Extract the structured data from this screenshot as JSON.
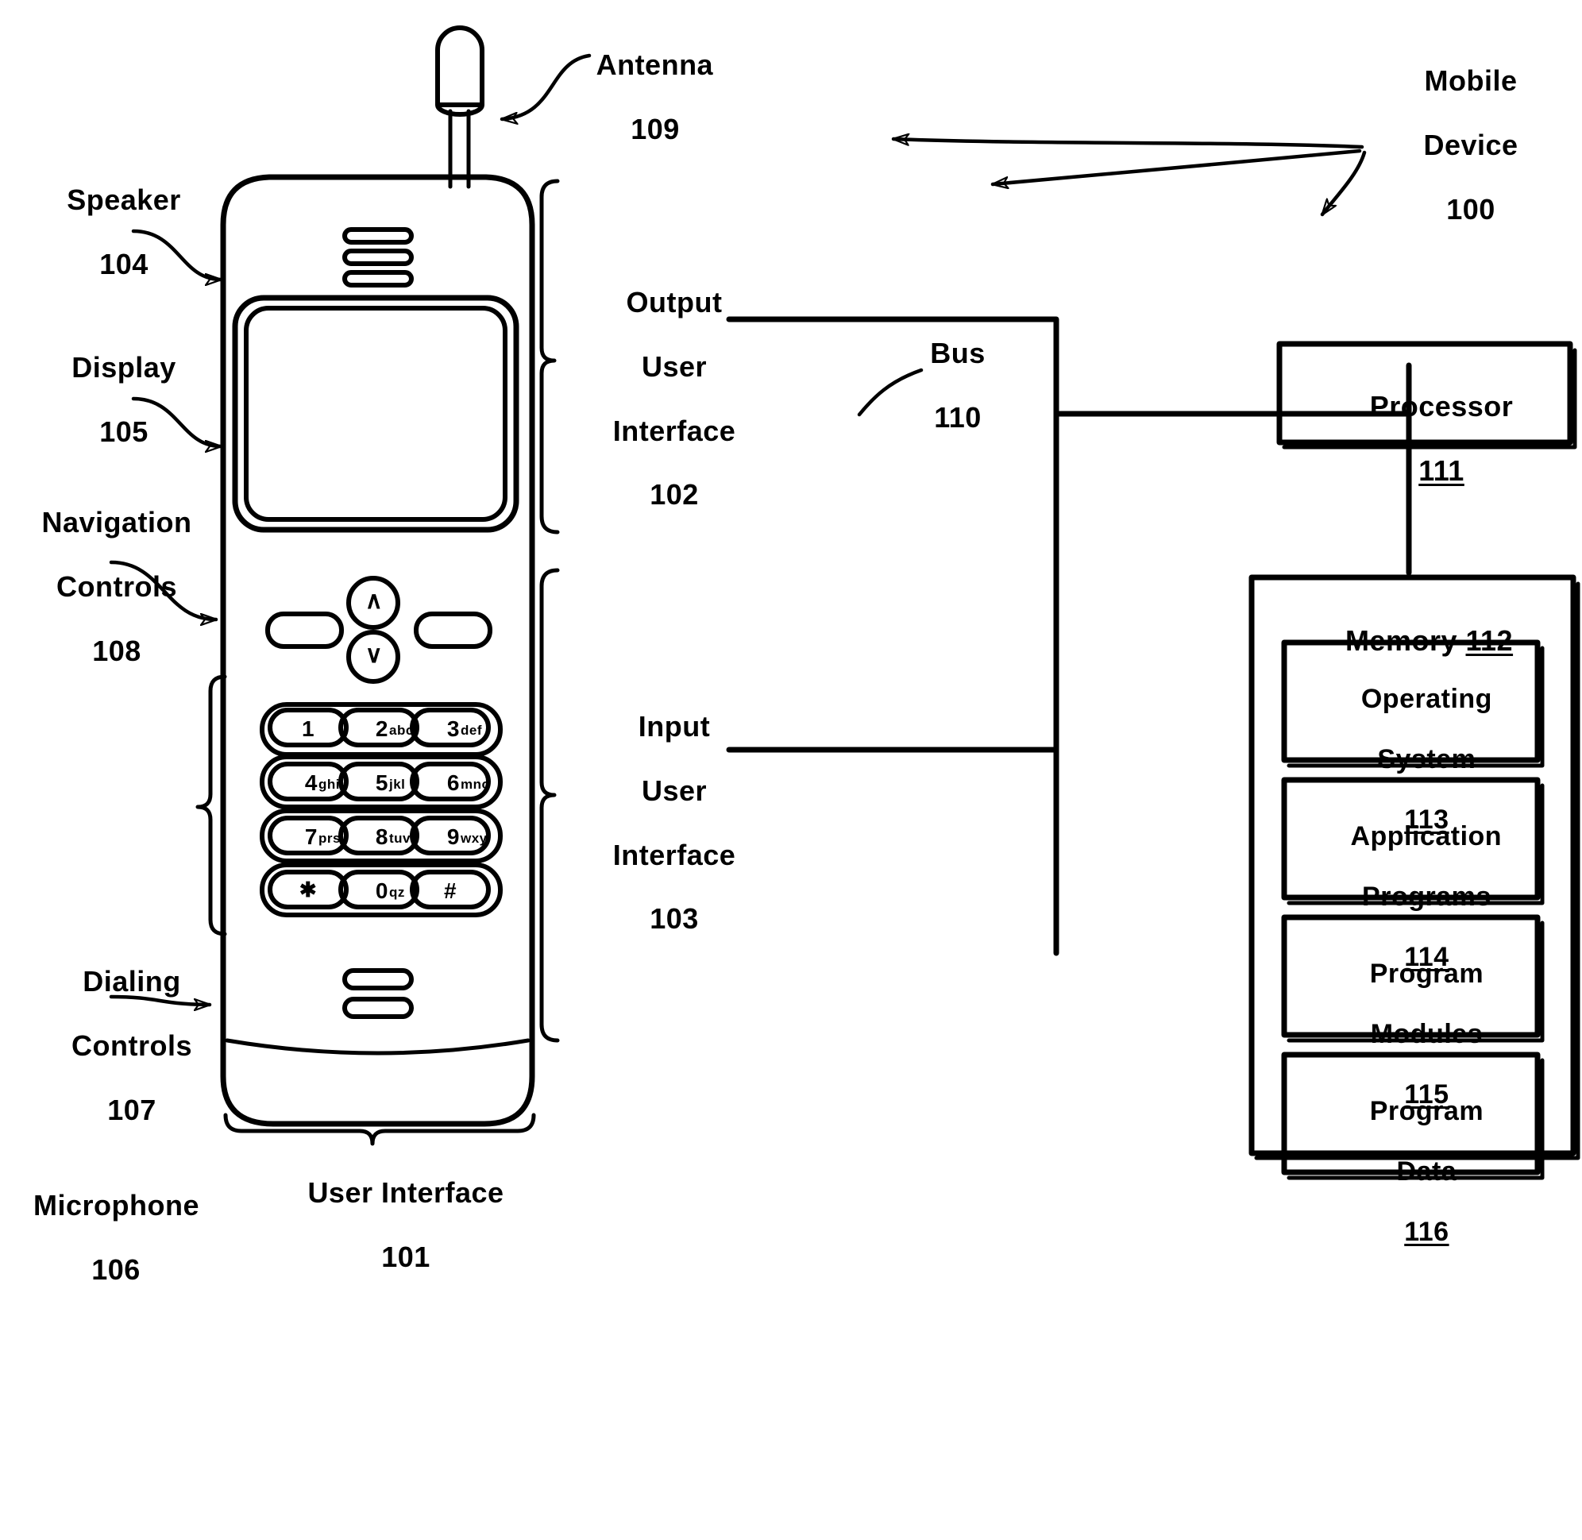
{
  "figure": {
    "kind": "patent-diagram",
    "background": "#ffffff",
    "ink": "#000000"
  },
  "callouts": {
    "antenna": {
      "name": "Antenna",
      "ref": "109"
    },
    "speaker": {
      "name": "Speaker",
      "ref": "104"
    },
    "display": {
      "name": "Display",
      "ref": "105"
    },
    "navigation": {
      "name": "Navigation\nControls",
      "line1": "Navigation",
      "line2": "Controls",
      "ref": "108"
    },
    "dialing": {
      "name": "Dialing\nControls",
      "line1": "Dialing",
      "line2": "Controls",
      "ref": "107"
    },
    "microphone": {
      "name": "Microphone",
      "ref": "106"
    },
    "user_interface": {
      "name": "User Interface",
      "ref": "101"
    },
    "output_ui": {
      "line1": "Output",
      "line2": "User",
      "line3": "Interface",
      "ref": "102"
    },
    "input_ui": {
      "line1": "Input",
      "line2": "User",
      "line3": "Interface",
      "ref": "103"
    },
    "bus": {
      "name": "Bus",
      "ref": "110"
    },
    "mobile_device": {
      "line1": "Mobile",
      "line2": "Device",
      "ref": "100"
    }
  },
  "blocks": {
    "processor": {
      "label": "Processor",
      "ref": "111"
    },
    "memory": {
      "label": "Memory",
      "ref": "112"
    },
    "memory_children": [
      {
        "line1": "Operating",
        "line2": "System",
        "ref": "113"
      },
      {
        "line1": "Application",
        "line2": "Programs",
        "ref": "114"
      },
      {
        "line1": "Program",
        "line2": "Modules",
        "ref": "115"
      },
      {
        "line1": "Program",
        "line2": "Data",
        "ref": "116"
      }
    ]
  },
  "phone": {
    "speaker_slots": 3,
    "microphone_slots": 2,
    "softkeys": [
      "",
      ""
    ],
    "nav_keys": [
      {
        "glyph": "∧",
        "name": "up"
      },
      {
        "glyph": "∨",
        "name": "down"
      }
    ],
    "keypad": [
      [
        {
          "digit": "1",
          "letters": ""
        },
        {
          "digit": "2",
          "letters": "abc"
        },
        {
          "digit": "3",
          "letters": "def"
        }
      ],
      [
        {
          "digit": "4",
          "letters": "ghi"
        },
        {
          "digit": "5",
          "letters": "jkl"
        },
        {
          "digit": "6",
          "letters": "mno"
        }
      ],
      [
        {
          "digit": "7",
          "letters": "prs"
        },
        {
          "digit": "8",
          "letters": "tuv"
        },
        {
          "digit": "9",
          "letters": "wxy"
        }
      ],
      [
        {
          "digit": "✱",
          "letters": ""
        },
        {
          "digit": "0",
          "letters": "qz"
        },
        {
          "digit": "#",
          "letters": ""
        }
      ]
    ]
  }
}
